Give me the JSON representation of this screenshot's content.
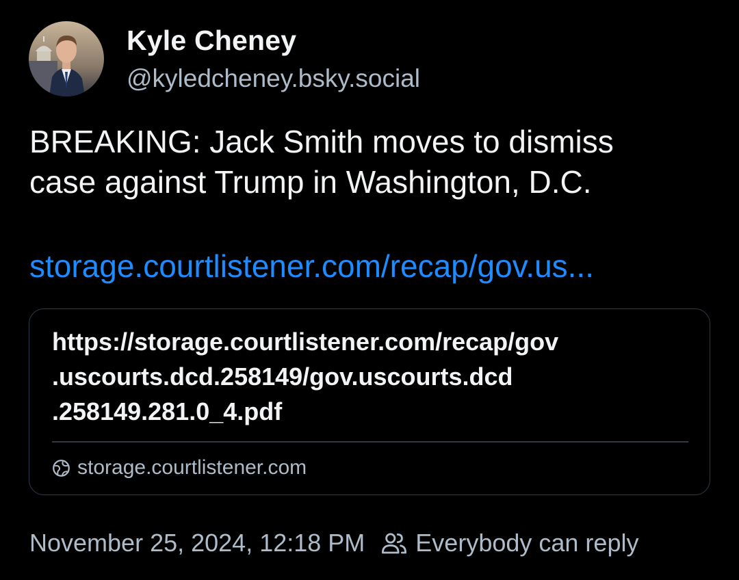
{
  "author": {
    "display_name": "Kyle Cheney",
    "handle": "@kyledcheney.bsky.social",
    "avatar_icon": "user-avatar"
  },
  "post": {
    "text_lines": [
      "BREAKING: Jack Smith moves to dismiss",
      "case against Trump in Washington, D.C."
    ],
    "link_text": "storage.courtlistener.com/recap/gov.us..."
  },
  "card": {
    "title_lines": [
      "https://storage.courtlistener.com/recap/gov",
      ".uscourts.dcd.258149/gov.uscourts.dcd",
      ".258149.281.0_4.pdf"
    ],
    "domain": "storage.courtlistener.com",
    "domain_icon": "globe-icon"
  },
  "meta": {
    "timestamp": "November 25, 2024, 12:18 PM",
    "reply_setting": "Everybody can reply",
    "reply_icon": "users-icon"
  },
  "colors": {
    "background": "#000000",
    "primary_text": "#f1f3f5",
    "secondary_text": "#aebbc9",
    "link": "#208bfe",
    "border": "#2e3a48"
  }
}
